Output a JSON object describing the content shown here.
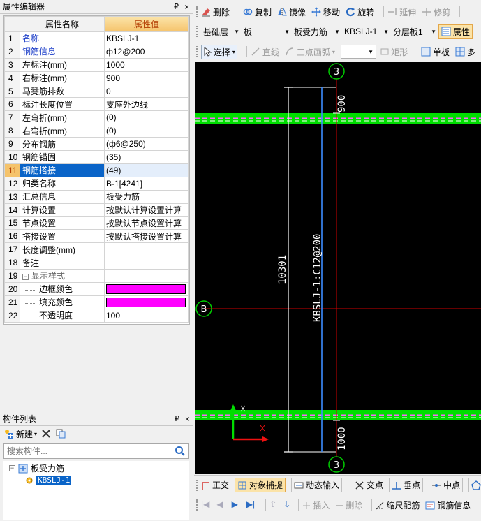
{
  "property_editor": {
    "title": "属性编辑器",
    "pin": "₽",
    "close": "×",
    "headers": {
      "name": "属性名称",
      "value": "属性值"
    },
    "rows": [
      {
        "num": "1",
        "name": "名称",
        "value": "KBSLJ-1",
        "style": "blue"
      },
      {
        "num": "2",
        "name": "钢筋信息",
        "value": "ф12@200",
        "style": "blue"
      },
      {
        "num": "3",
        "name": "左标注(mm)",
        "value": "1000",
        "style": ""
      },
      {
        "num": "4",
        "name": "右标注(mm)",
        "value": "900",
        "style": ""
      },
      {
        "num": "5",
        "name": "马凳筋排数",
        "value": "0",
        "style": ""
      },
      {
        "num": "6",
        "name": "标注长度位置",
        "value": "支座外边线",
        "style": ""
      },
      {
        "num": "7",
        "name": "左弯折(mm)",
        "value": "(0)",
        "style": ""
      },
      {
        "num": "8",
        "name": "右弯折(mm)",
        "value": "(0)",
        "style": ""
      },
      {
        "num": "9",
        "name": "分布钢筋",
        "value": "(ф6@250)",
        "style": ""
      },
      {
        "num": "10",
        "name": "钢筋锚固",
        "value": "(35)",
        "style": ""
      },
      {
        "num": "11",
        "name": "钢筋搭接",
        "value": "(49)",
        "style": "selected"
      },
      {
        "num": "12",
        "name": "归类名称",
        "value": "B-1[4241]",
        "style": ""
      },
      {
        "num": "13",
        "name": "汇总信息",
        "value": "板受力筋",
        "style": ""
      },
      {
        "num": "14",
        "name": "计算设置",
        "value": "按默认计算设置计算",
        "style": ""
      },
      {
        "num": "15",
        "name": "节点设置",
        "value": "按默认节点设置计算",
        "style": ""
      },
      {
        "num": "16",
        "name": "搭接设置",
        "value": "按默认搭接设置计算",
        "style": ""
      },
      {
        "num": "17",
        "name": "长度调整(mm)",
        "value": "",
        "style": ""
      },
      {
        "num": "18",
        "name": "备注",
        "value": "",
        "style": ""
      },
      {
        "num": "19",
        "name": "显示样式",
        "value": "",
        "style": "group"
      },
      {
        "num": "20",
        "name": "边框颜色",
        "value": "",
        "style": "swatch"
      },
      {
        "num": "21",
        "name": "填充颜色",
        "value": "",
        "style": "swatch"
      },
      {
        "num": "22",
        "name": "不透明度",
        "value": "100",
        "style": "child"
      }
    ],
    "group_toggle": "−"
  },
  "component_list": {
    "title": "构件列表",
    "pin": "₽",
    "close": "×",
    "new_label": "新建",
    "search_placeholder": "搜索构件...",
    "tree_root_toggle": "−",
    "tree_root": "板受力筋",
    "tree_child": "KBSLJ-1"
  },
  "toolbar1": {
    "delete": "删除",
    "copy": "复制",
    "mirror": "镜像",
    "move": "移动",
    "rotate": "旋转",
    "extend": "延伸",
    "trim": "修剪"
  },
  "toolbar2": {
    "layer": "基础层",
    "category": "板",
    "type": "板受力筋",
    "component": "KBSLJ-1",
    "sublayer": "分层板1",
    "properties": "属性"
  },
  "toolbar3": {
    "select": "选择",
    "line": "直线",
    "arc": "三点画弧",
    "rect": "矩形",
    "single_board": "单板",
    "multi": "多"
  },
  "canvas": {
    "axis_top": "3",
    "axis_bottom": "3",
    "axis_left": "B",
    "dim_top": "900",
    "dim_bottom": "1000",
    "dim_total": "10301",
    "rebar_label": "KBSLJ-1:C12@200",
    "colors": {
      "slab_band": "#00dd00",
      "rebar": "#3c8cff",
      "axis": "#cc0000",
      "dim": "#ffffff",
      "axis_circle": "#00cc00"
    }
  },
  "status1": {
    "ortho": "正交",
    "snap": "对象捕捉",
    "dynamic": "动态输入",
    "intersect": "交点",
    "perp": "垂点",
    "mid": "中点",
    "vertex": "顶"
  },
  "status2": {
    "insert": "插入",
    "delete": "删除",
    "scale": "缩尺配筋",
    "rebar_info": "钢筋信息"
  }
}
